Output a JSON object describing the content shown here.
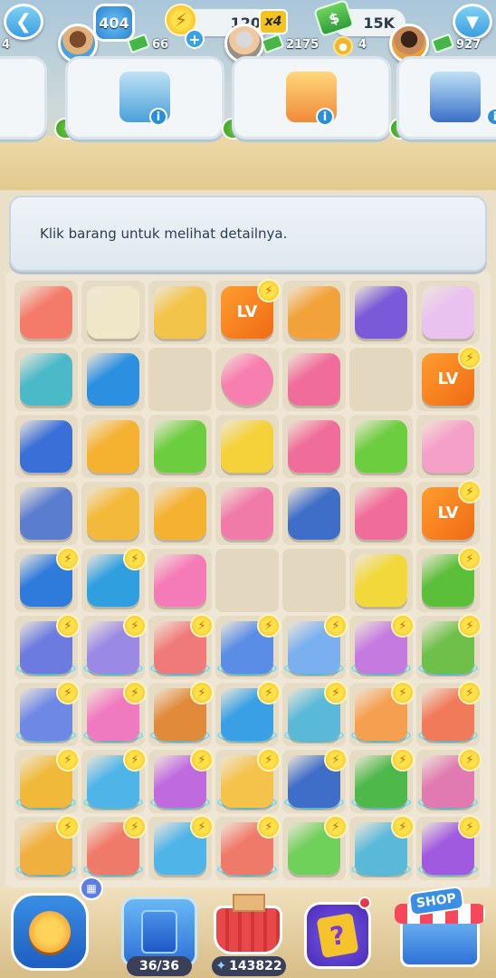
{
  "header": {
    "back_icon": "chevron-left-icon",
    "level": "404",
    "energy": "120",
    "energy_multiplier": "x4",
    "cash_total": "15K",
    "menu_icon": "chevron-down-icon",
    "left_partial_cash": "4"
  },
  "customers": [
    {
      "cash": "66",
      "item": "beach-chair",
      "avatar_color": "#4ba3d8"
    },
    {
      "cash": "2175",
      "item": "pool-lounger",
      "avatar_color": "#9a8f83",
      "coins": "4"
    },
    {
      "cash": "927",
      "item": "drum-set",
      "avatar_color": "#e3a23d"
    }
  ],
  "banner": {
    "text": "Klik barang untuk melihat detailnya."
  },
  "grid": [
    [
      {
        "n": "sushi-item",
        "c": "#f47a6a"
      },
      {
        "n": "pearl-earrings-item",
        "c": "#f0e6c8"
      },
      {
        "n": "gold-necklace-item",
        "c": "#f3c44a"
      },
      {
        "n": "level-up-item",
        "c": "lv",
        "bolt": true
      },
      {
        "n": "fruit-basket-item",
        "c": "#f2a23a"
      },
      {
        "n": "glove-item",
        "c": "#7a5ad8"
      },
      {
        "n": "scissors-item",
        "c": "#e9c2f0"
      }
    ],
    [
      {
        "n": "tennis-racket-item",
        "c": "#4bb9c8"
      },
      {
        "n": "tent-item",
        "c": "#2c8fe0"
      },
      {
        "n": "",
        "c": ""
      },
      {
        "n": "swim-ring-item",
        "c": "#f77fb0",
        "round": true
      },
      {
        "n": "guitar-item",
        "c": "#f06c9a"
      },
      {
        "n": "",
        "c": ""
      },
      {
        "n": "level-up-item",
        "c": "lv",
        "bolt": true
      }
    ],
    [
      {
        "n": "sapphire-earrings-item",
        "c": "#3a6fd8"
      },
      {
        "n": "bread-item",
        "c": "#f5b130"
      },
      {
        "n": "green-stool-item",
        "c": "#6ccd3f"
      },
      {
        "n": "rose-bouquet-item",
        "c": "#f5d13a"
      },
      {
        "n": "guitar-item",
        "c": "#f06c9a"
      },
      {
        "n": "high-chair-item",
        "c": "#6ccd3f"
      },
      {
        "n": "trumpet-item",
        "c": "#f5a0c8"
      }
    ],
    [
      {
        "n": "diamond-earrings-item",
        "c": "#5a7dd0"
      },
      {
        "n": "wind-chime-item",
        "c": "#f2b93a"
      },
      {
        "n": "bread-item",
        "c": "#f5b130"
      },
      {
        "n": "saxophone-item",
        "c": "#f07aa8"
      },
      {
        "n": "drum-item",
        "c": "#3f6ec8"
      },
      {
        "n": "accordion-item",
        "c": "#f06c9a"
      },
      {
        "n": "level-up-item",
        "c": "lv",
        "bolt": true
      }
    ],
    [
      {
        "n": "projector-generator",
        "c": "#2f7bdc",
        "bolt": true
      },
      {
        "n": "camera-generator",
        "c": "#2f9fe0",
        "bolt": true
      },
      {
        "n": "butterfly-item",
        "c": "#f57bb8"
      },
      {
        "n": "",
        "c": ""
      },
      {
        "n": "",
        "c": ""
      },
      {
        "n": "butterfly-item",
        "c": "#f2d83a"
      },
      {
        "n": "treehouse-generator",
        "c": "#5bbf3a",
        "bolt": true
      }
    ],
    [
      {
        "n": "clothes-rack-generator",
        "c": "#6b7be0",
        "bolt": true,
        "glow": true
      },
      {
        "n": "bottle-shelf-generator",
        "c": "#9a8ae6",
        "bolt": true,
        "glow": true
      },
      {
        "n": "toy-cart-generator",
        "c": "#f07a7a",
        "bolt": true,
        "glow": true
      },
      {
        "n": "desk-generator",
        "c": "#5a8ee6",
        "bolt": true,
        "glow": true
      },
      {
        "n": "washing-generator",
        "c": "#7ab0f0",
        "bolt": true,
        "glow": true
      },
      {
        "n": "chest-generator",
        "c": "#c47adf",
        "bolt": true,
        "glow": true
      },
      {
        "n": "wardrobe-generator",
        "c": "#6fc04a",
        "bolt": true,
        "glow": true
      }
    ],
    [
      {
        "n": "fountain-generator",
        "c": "#6e88e6",
        "bolt": true,
        "glow": true
      },
      {
        "n": "piano-generator",
        "c": "#f07ac0",
        "bolt": true,
        "glow": true
      },
      {
        "n": "workshop-generator",
        "c": "#e08a3a",
        "bolt": true,
        "glow": true
      },
      {
        "n": "arch-generator",
        "c": "#3aa0e6",
        "bolt": true,
        "glow": true
      },
      {
        "n": "lifeguard-generator",
        "c": "#5ab9d8",
        "bolt": true,
        "glow": true
      },
      {
        "n": "toybox-generator",
        "c": "#f5a050",
        "bolt": true,
        "glow": true
      },
      {
        "n": "carousel-generator",
        "c": "#f07a5a",
        "bolt": true,
        "glow": true
      }
    ],
    [
      {
        "n": "lamp-generator",
        "c": "#f0b93a",
        "bolt": true,
        "glow": true
      },
      {
        "n": "scissors-box-generator",
        "c": "#4fb4e8",
        "bolt": true,
        "glow": true
      },
      {
        "n": "clock-generator",
        "c": "#c06ae0",
        "bolt": true,
        "glow": true
      },
      {
        "n": "cabinet-generator",
        "c": "#f5c24a",
        "bolt": true,
        "glow": true
      },
      {
        "n": "book-generator",
        "c": "#3f6ec8",
        "bolt": true,
        "glow": true
      },
      {
        "n": "grill-generator",
        "c": "#4fb84a",
        "bolt": true,
        "glow": true
      },
      {
        "n": "cake-generator",
        "c": "#e07ab0",
        "bolt": true,
        "glow": true
      }
    ],
    [
      {
        "n": "flower-box-generator",
        "c": "#f0b040",
        "bolt": true,
        "glow": true
      },
      {
        "n": "tulip-pot-generator",
        "c": "#f07a6a",
        "bolt": true,
        "glow": true
      },
      {
        "n": "scissors-box-generator",
        "c": "#4fb4e8",
        "bolt": true
      },
      {
        "n": "tulip-pot-generator",
        "c": "#f07a6a",
        "bolt": true,
        "glow": true
      },
      {
        "n": "scissors-box-generator",
        "c": "#6fd05a",
        "bolt": true
      },
      {
        "n": "lifeguard-generator",
        "c": "#5ab9d8",
        "bolt": true,
        "glow": true
      },
      {
        "n": "cash-register-generator",
        "c": "#a05ae0",
        "bolt": true,
        "glow": true
      }
    ]
  ],
  "bottom": {
    "storage_count": "36/36",
    "basket_value": "143822",
    "shop_label": "SHOP",
    "trophy_icon": "trophy-icon",
    "basket_icon": "basket-icon",
    "mystery_icon": "mystery-card-icon"
  }
}
